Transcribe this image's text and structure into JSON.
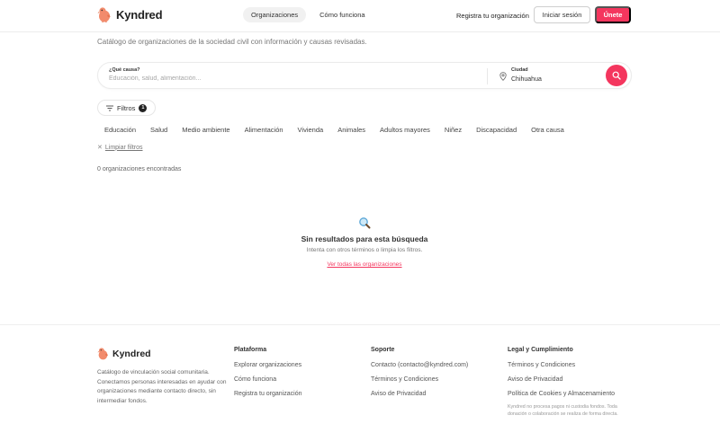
{
  "header": {
    "brand": "Kyndred",
    "nav": [
      {
        "label": "Organizaciones",
        "active": true
      },
      {
        "label": "Cómo funciona",
        "active": false
      }
    ],
    "register_label": "Registra tu organización",
    "login_label": "Iniciar sesión",
    "join_label": "Únete"
  },
  "subtitle": "Catálogo de organizaciones de la sociedad civil con información y causas revisadas.",
  "search": {
    "cause_label": "¿Qué causa?",
    "cause_placeholder": "Educación, salud, alimentación...",
    "cause_value": "",
    "city_label": "Ciudad",
    "city_value": "Chihuahua",
    "search_icon": "search-icon",
    "pin_icon": "map-pin-icon"
  },
  "filters": {
    "label": "Filtros",
    "active_count": "1",
    "categories": [
      "Educación",
      "Salud",
      "Medio ambiente",
      "Alimentación",
      "Vivienda",
      "Animales",
      "Adultos mayores",
      "Niñez",
      "Discapacidad",
      "Otra causa"
    ],
    "clear_label": "Limpiar filtros"
  },
  "results": {
    "count_text": "0 organizaciones encontradas",
    "empty_title": "Sin resultados para esta búsqueda",
    "empty_subtitle": "Intenta con otros términos o limpia los filtros.",
    "empty_link": "Ver todas las organizaciones"
  },
  "footer": {
    "brand": "Kyndred",
    "description": "Catálogo de vinculación social comunitaria. Conectamos personas interesadas en ayudar con organizaciones mediante contacto directo, sin intermediar fondos.",
    "columns": [
      {
        "title": "Plataforma",
        "links": [
          "Explorar organizaciones",
          "Cómo funciona",
          "Registra tu organización"
        ]
      },
      {
        "title": "Soporte",
        "links": [
          "Contacto (contacto@kyndred.com)",
          "Términos y Condiciones",
          "Aviso de Privacidad"
        ]
      },
      {
        "title": "Legal y Cumplimiento",
        "links": [
          "Términos y Condiciones",
          "Aviso de Privacidad",
          "Política de Cookies y Almacenamiento"
        ]
      }
    ],
    "note": "Kyndred no procesa pagos ni custodia fondos. Toda donación o colaboración se realiza de forma directa."
  },
  "colors": {
    "accent": "#f4365e",
    "text": "#2d2d2d",
    "muted": "#777777",
    "border": "#ececec"
  }
}
